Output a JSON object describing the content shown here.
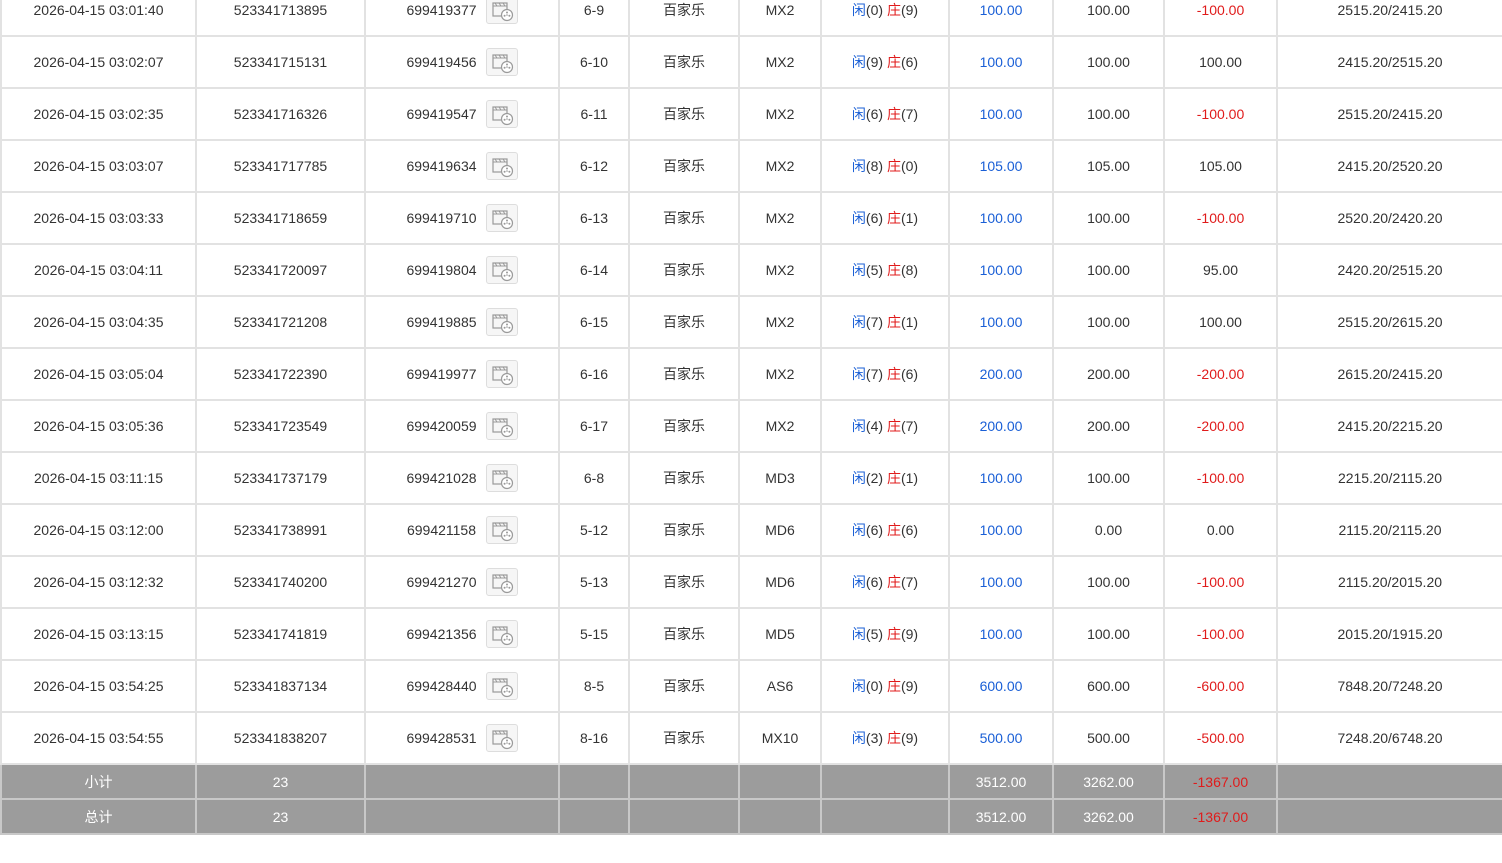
{
  "rows": [
    {
      "time": "2026-04-15 03:01:40",
      "bet_no": "523341713895",
      "game_no": "699419377",
      "table": "6-9",
      "game": "百家乐",
      "room": "MX2",
      "player_label": "闲",
      "player_score": "(0)",
      "banker_label": "庄",
      "banker_score": "(9)",
      "bet": "100.00",
      "valid": "100.00",
      "win": "-100.00",
      "win_neg": true,
      "balance": "2515.20/2415.20"
    },
    {
      "time": "2026-04-15 03:02:07",
      "bet_no": "523341715131",
      "game_no": "699419456",
      "table": "6-10",
      "game": "百家乐",
      "room": "MX2",
      "player_label": "闲",
      "player_score": "(9)",
      "banker_label": "庄",
      "banker_score": "(6)",
      "bet": "100.00",
      "valid": "100.00",
      "win": "100.00",
      "win_neg": false,
      "balance": "2415.20/2515.20"
    },
    {
      "time": "2026-04-15 03:02:35",
      "bet_no": "523341716326",
      "game_no": "699419547",
      "table": "6-11",
      "game": "百家乐",
      "room": "MX2",
      "player_label": "闲",
      "player_score": "(6)",
      "banker_label": "庄",
      "banker_score": "(7)",
      "bet": "100.00",
      "valid": "100.00",
      "win": "-100.00",
      "win_neg": true,
      "balance": "2515.20/2415.20"
    },
    {
      "time": "2026-04-15 03:03:07",
      "bet_no": "523341717785",
      "game_no": "699419634",
      "table": "6-12",
      "game": "百家乐",
      "room": "MX2",
      "player_label": "闲",
      "player_score": "(8)",
      "banker_label": "庄",
      "banker_score": "(0)",
      "bet": "105.00",
      "valid": "105.00",
      "win": "105.00",
      "win_neg": false,
      "balance": "2415.20/2520.20"
    },
    {
      "time": "2026-04-15 03:03:33",
      "bet_no": "523341718659",
      "game_no": "699419710",
      "table": "6-13",
      "game": "百家乐",
      "room": "MX2",
      "player_label": "闲",
      "player_score": "(6)",
      "banker_label": "庄",
      "banker_score": "(1)",
      "bet": "100.00",
      "valid": "100.00",
      "win": "-100.00",
      "win_neg": true,
      "balance": "2520.20/2420.20"
    },
    {
      "time": "2026-04-15 03:04:11",
      "bet_no": "523341720097",
      "game_no": "699419804",
      "table": "6-14",
      "game": "百家乐",
      "room": "MX2",
      "player_label": "闲",
      "player_score": "(5)",
      "banker_label": "庄",
      "banker_score": "(8)",
      "bet": "100.00",
      "valid": "100.00",
      "win": "95.00",
      "win_neg": false,
      "balance": "2420.20/2515.20"
    },
    {
      "time": "2026-04-15 03:04:35",
      "bet_no": "523341721208",
      "game_no": "699419885",
      "table": "6-15",
      "game": "百家乐",
      "room": "MX2",
      "player_label": "闲",
      "player_score": "(7)",
      "banker_label": "庄",
      "banker_score": "(1)",
      "bet": "100.00",
      "valid": "100.00",
      "win": "100.00",
      "win_neg": false,
      "balance": "2515.20/2615.20"
    },
    {
      "time": "2026-04-15 03:05:04",
      "bet_no": "523341722390",
      "game_no": "699419977",
      "table": "6-16",
      "game": "百家乐",
      "room": "MX2",
      "player_label": "闲",
      "player_score": "(7)",
      "banker_label": "庄",
      "banker_score": "(6)",
      "bet": "200.00",
      "valid": "200.00",
      "win": "-200.00",
      "win_neg": true,
      "balance": "2615.20/2415.20"
    },
    {
      "time": "2026-04-15 03:05:36",
      "bet_no": "523341723549",
      "game_no": "699420059",
      "table": "6-17",
      "game": "百家乐",
      "room": "MX2",
      "player_label": "闲",
      "player_score": "(4)",
      "banker_label": "庄",
      "banker_score": "(7)",
      "bet": "200.00",
      "valid": "200.00",
      "win": "-200.00",
      "win_neg": true,
      "balance": "2415.20/2215.20"
    },
    {
      "time": "2026-04-15 03:11:15",
      "bet_no": "523341737179",
      "game_no": "699421028",
      "table": "6-8",
      "game": "百家乐",
      "room": "MD3",
      "player_label": "闲",
      "player_score": "(2)",
      "banker_label": "庄",
      "banker_score": "(1)",
      "bet": "100.00",
      "valid": "100.00",
      "win": "-100.00",
      "win_neg": true,
      "balance": "2215.20/2115.20"
    },
    {
      "time": "2026-04-15 03:12:00",
      "bet_no": "523341738991",
      "game_no": "699421158",
      "table": "5-12",
      "game": "百家乐",
      "room": "MD6",
      "player_label": "闲",
      "player_score": "(6)",
      "banker_label": "庄",
      "banker_score": "(6)",
      "bet": "100.00",
      "valid": "0.00",
      "win": "0.00",
      "win_neg": false,
      "balance": "2115.20/2115.20"
    },
    {
      "time": "2026-04-15 03:12:32",
      "bet_no": "523341740200",
      "game_no": "699421270",
      "table": "5-13",
      "game": "百家乐",
      "room": "MD6",
      "player_label": "闲",
      "player_score": "(6)",
      "banker_label": "庄",
      "banker_score": "(7)",
      "bet": "100.00",
      "valid": "100.00",
      "win": "-100.00",
      "win_neg": true,
      "balance": "2115.20/2015.20"
    },
    {
      "time": "2026-04-15 03:13:15",
      "bet_no": "523341741819",
      "game_no": "699421356",
      "table": "5-15",
      "game": "百家乐",
      "room": "MD5",
      "player_label": "闲",
      "player_score": "(5)",
      "banker_label": "庄",
      "banker_score": "(9)",
      "bet": "100.00",
      "valid": "100.00",
      "win": "-100.00",
      "win_neg": true,
      "balance": "2015.20/1915.20"
    },
    {
      "time": "2026-04-15 03:54:25",
      "bet_no": "523341837134",
      "game_no": "699428440",
      "table": "8-5",
      "game": "百家乐",
      "room": "AS6",
      "player_label": "闲",
      "player_score": "(0)",
      "banker_label": "庄",
      "banker_score": "(9)",
      "bet": "600.00",
      "valid": "600.00",
      "win": "-600.00",
      "win_neg": true,
      "balance": "7848.20/7248.20"
    },
    {
      "time": "2026-04-15 03:54:55",
      "bet_no": "523341838207",
      "game_no": "699428531",
      "table": "8-16",
      "game": "百家乐",
      "room": "MX10",
      "player_label": "闲",
      "player_score": "(3)",
      "banker_label": "庄",
      "banker_score": "(9)",
      "bet": "500.00",
      "valid": "500.00",
      "win": "-500.00",
      "win_neg": true,
      "balance": "7248.20/6748.20"
    }
  ],
  "subtotal": {
    "label": "小计",
    "count": "23",
    "bet": "3512.00",
    "valid": "3262.00",
    "win": "-1367.00"
  },
  "total": {
    "label": "总计",
    "count": "23",
    "bet": "3512.00",
    "valid": "3262.00",
    "win": "-1367.00"
  },
  "icons": {
    "replay": "video-replay-icon"
  },
  "colors": {
    "blue": "#1a5fd6",
    "red": "#e01b1b",
    "summary_bg": "#9c9c9c"
  }
}
